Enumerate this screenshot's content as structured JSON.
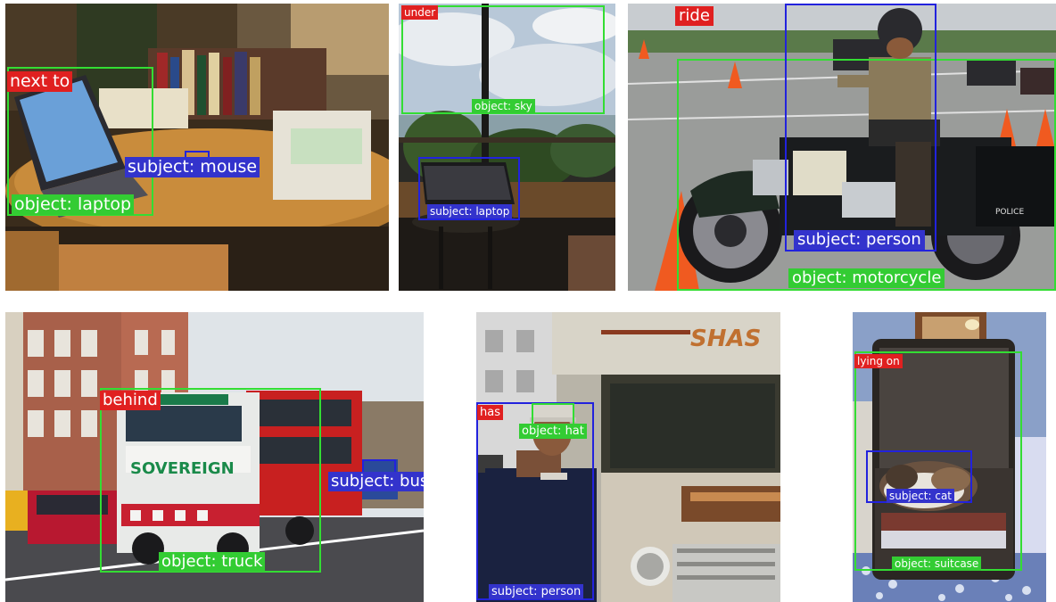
{
  "colors": {
    "predicate_label": "#e02020",
    "object_box": "#33dd33",
    "subject_box": "#2222dd"
  },
  "panels": [
    {
      "predicate": "next to",
      "subject": "subject: mouse",
      "object": "object: laptop"
    },
    {
      "predicate": "under",
      "subject": "subject: laptop",
      "object": "object: sky"
    },
    {
      "predicate": "ride",
      "subject": "subject: person",
      "object": "object: motorcycle"
    },
    {
      "predicate": "behind",
      "subject": "subject: bus",
      "object": "object: truck"
    },
    {
      "predicate": "has",
      "subject": "subject: person",
      "object": "object: hat"
    },
    {
      "predicate": "lying on",
      "subject": "subject: cat",
      "object": "object: suitcase"
    }
  ],
  "image_text": {
    "truck_brand": "SOVEREIGN",
    "rv_brand": "SHAS",
    "police": "POLICE"
  }
}
